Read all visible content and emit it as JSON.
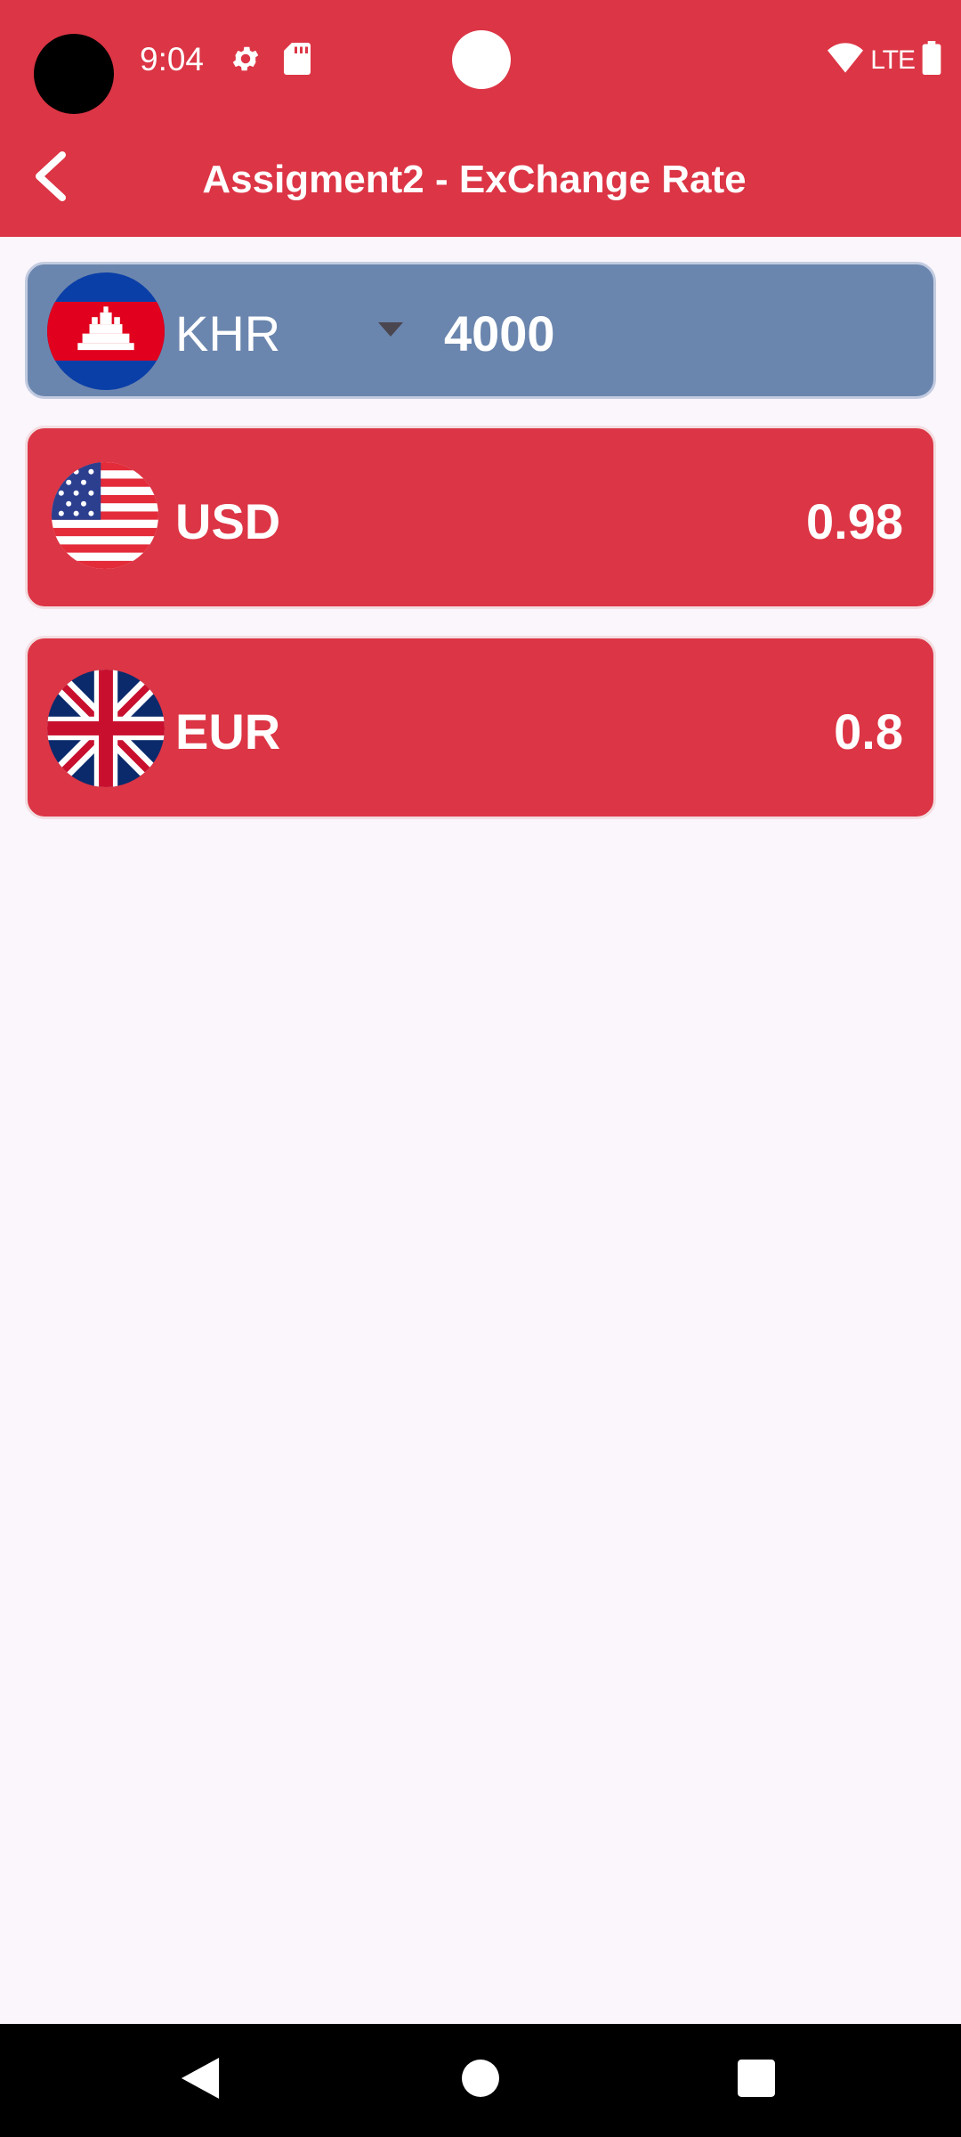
{
  "status_bar": {
    "time": "9:04",
    "network": "LTE",
    "icons": [
      "settings-icon",
      "sd-card-icon",
      "wifi-icon",
      "battery-icon"
    ]
  },
  "app_bar": {
    "title": "Assigment2 - ExChange Rate",
    "back_icon": "chevron-left-icon"
  },
  "base_currency": {
    "code": "KHR",
    "amount": "4000",
    "flag": "cambodia-flag-icon"
  },
  "conversions": [
    {
      "code": "USD",
      "value": "0.98",
      "flag": "usa-flag-icon"
    },
    {
      "code": "EUR",
      "value": "0.8",
      "flag": "uk-flag-icon"
    }
  ],
  "colors": {
    "primary": "#dc3545",
    "selector": "#6b86ae",
    "background": "#fbf6fc"
  },
  "nav_bar": {
    "buttons": [
      "back-icon",
      "home-icon",
      "recents-icon"
    ]
  }
}
